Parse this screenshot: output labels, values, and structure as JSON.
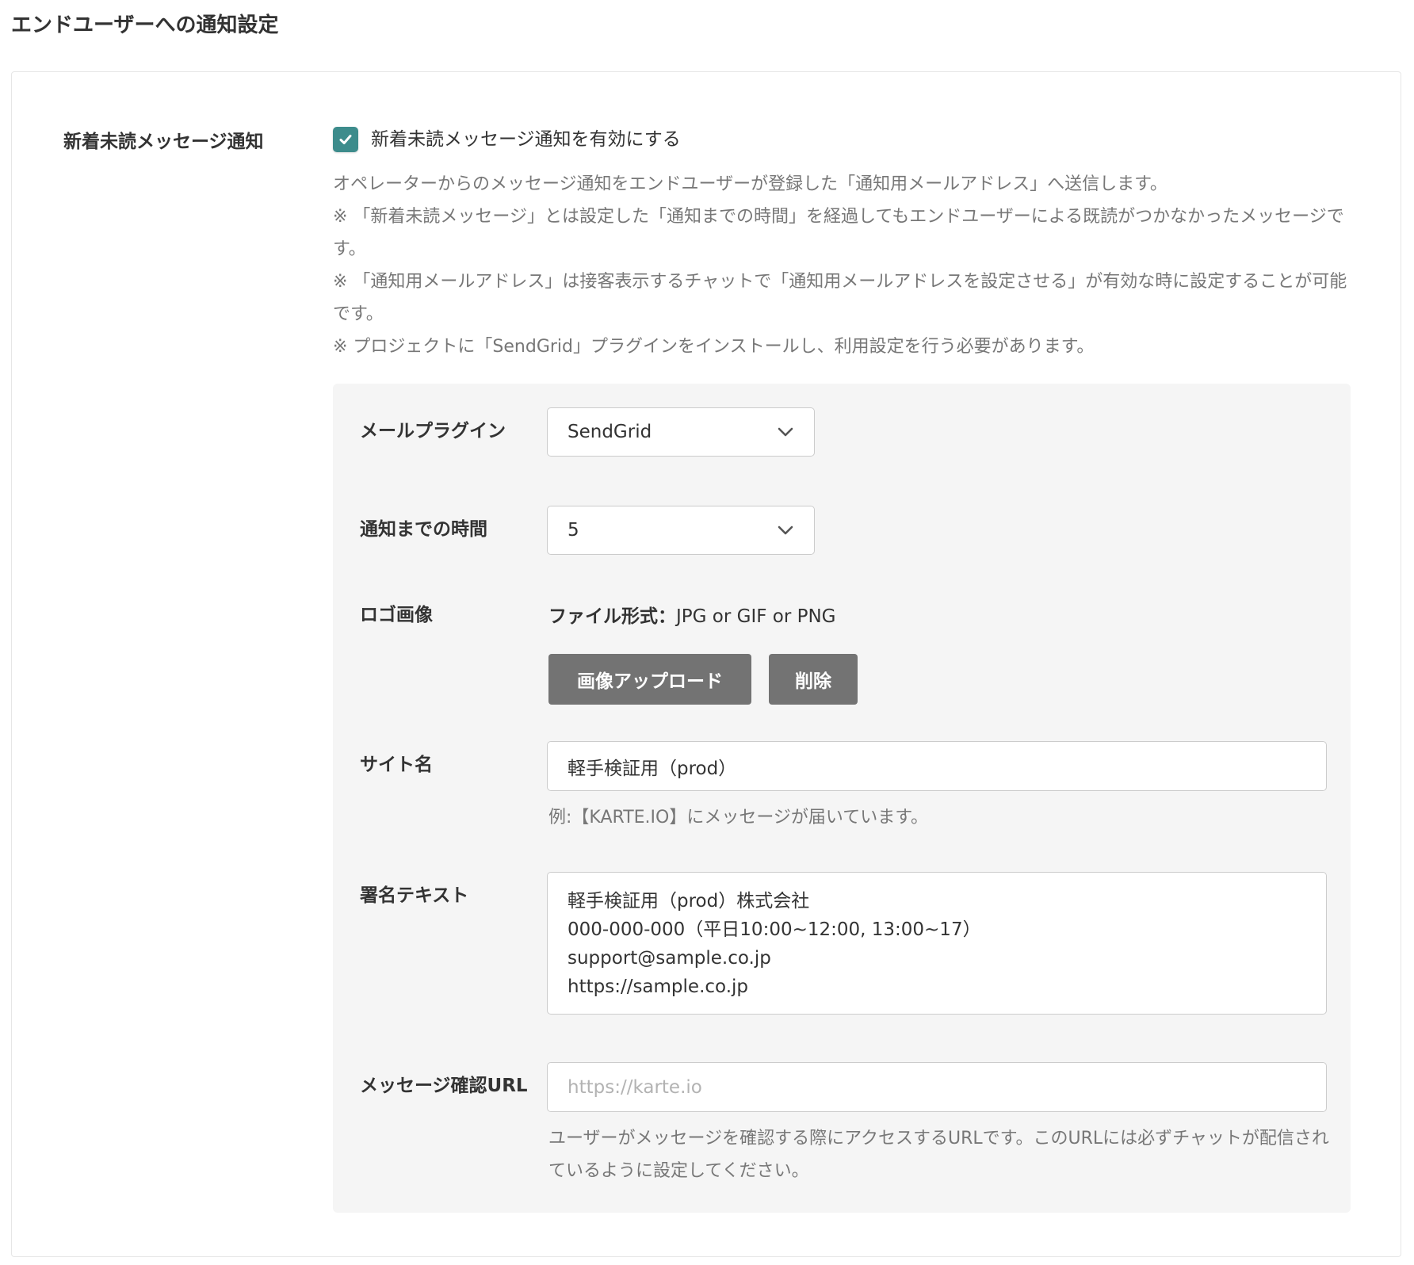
{
  "page": {
    "title": "エンドユーザーへの通知設定"
  },
  "notification": {
    "section_label": "新着未読メッセージ通知",
    "checkbox_label": "新着未読メッセージ通知を有効にする",
    "checked": true,
    "description": [
      "オペレーターからのメッセージ通知をエンドユーザーが登録した「通知用メールアドレス」へ送信します。",
      "※ 「新着未読メッセージ」とは設定した「通知までの時間」を経過してもエンドユーザーによる既読がつかなかったメッセージです。",
      "※ 「通知用メールアドレス」は接客表示するチャットで「通知用メールアドレスを設定させる」が有効な時に設定することが可能です。",
      "※ プロジェクトに「SendGrid」プラグインをインストールし、利用設定を行う必要があります。"
    ]
  },
  "form": {
    "mail_plugin": {
      "label": "メールプラグイン",
      "value": "SendGrid"
    },
    "notify_time": {
      "label": "通知までの時間",
      "value": "5"
    },
    "logo": {
      "label": "ロゴ画像",
      "format_key": "ファイル形式：",
      "format_value": "JPG or GIF or PNG",
      "upload_button": "画像アップロード",
      "delete_button": "削除"
    },
    "site_name": {
      "label": "サイト名",
      "value": "軽手検証用（prod）",
      "hint": "例:【KARTE.IO】にメッセージが届いています。"
    },
    "signature": {
      "label": "署名テキスト",
      "lines": [
        "軽手検証用（prod）株式会社",
        "000-000-000（平日10:00~12:00, 13:00~17）",
        "support@sample.co.jp",
        "https://sample.co.jp"
      ]
    },
    "message_url": {
      "label": "メッセージ確認URL",
      "placeholder": "https://karte.io",
      "hint": "ユーザーがメッセージを確認する際にアクセスするURLです。このURLには必ずチャットが配信されているように設定してください。"
    }
  },
  "colors": {
    "accent": "#3d8c8c",
    "button": "#737373",
    "panel": "#f5f5f5"
  }
}
